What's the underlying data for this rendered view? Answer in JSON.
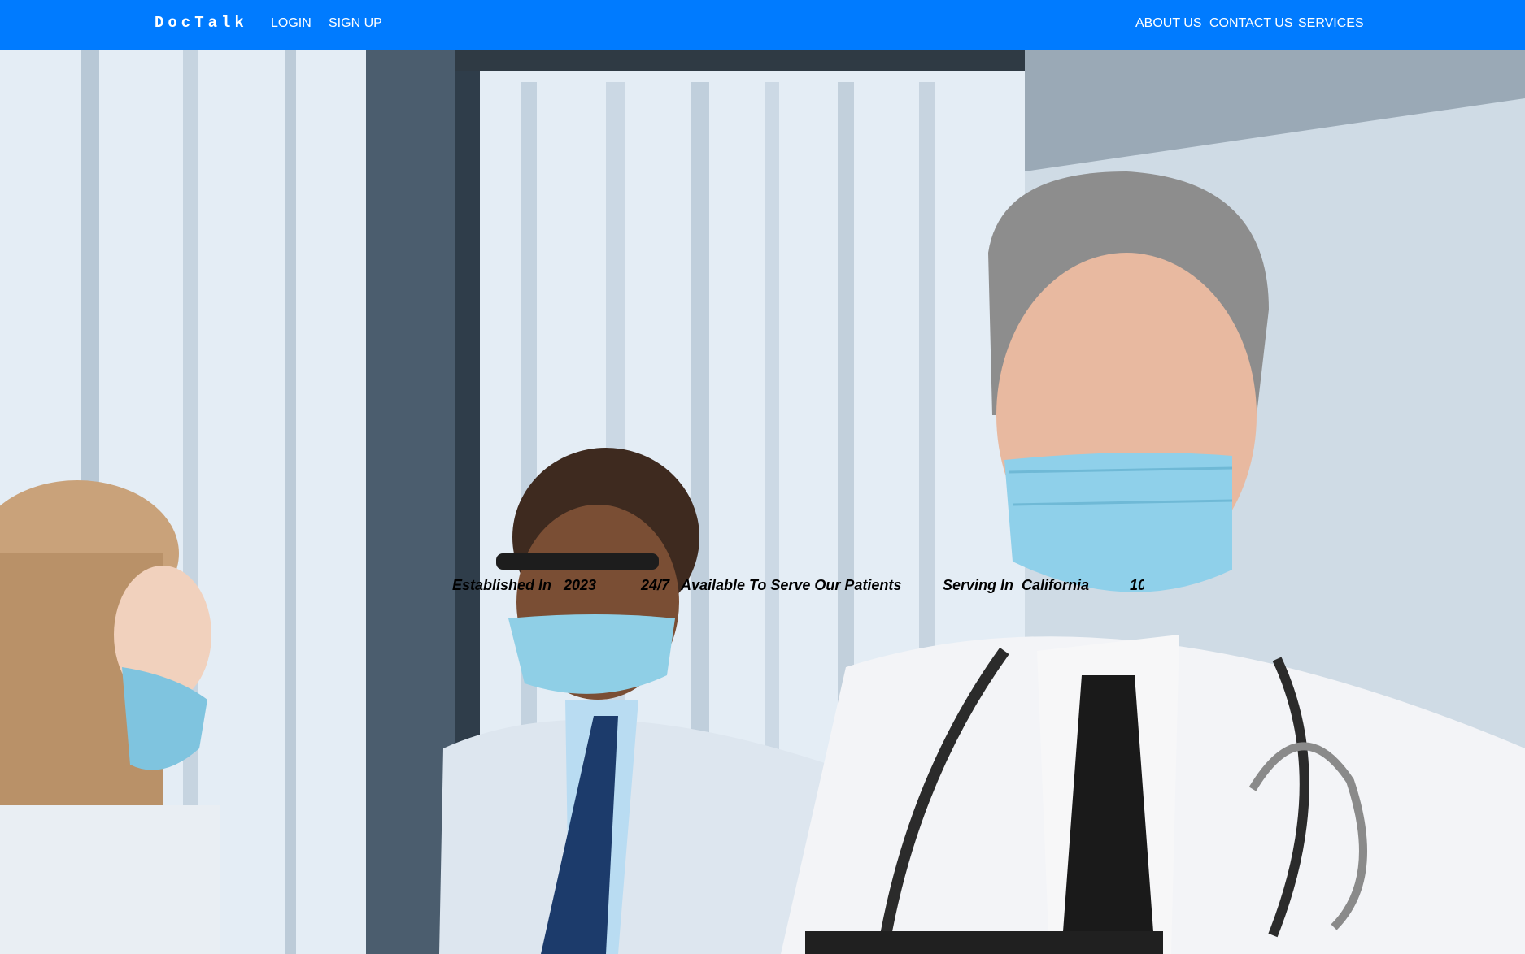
{
  "navbar": {
    "brand": "DocTalk",
    "left_links": [
      "LOGIN",
      "SIGN UP"
    ],
    "right_links": [
      "ABOUT US",
      "CONTACT US",
      "SERVICES"
    ],
    "background_color": "#007bff"
  },
  "hero": {
    "ticker": [
      {
        "label": "Established In",
        "value": "2023"
      },
      {
        "label": "24/7",
        "value": "Available To Serve Our Patients"
      },
      {
        "label": "Serving In",
        "value": "California"
      },
      {
        "label": "10",
        "value": ""
      }
    ]
  }
}
